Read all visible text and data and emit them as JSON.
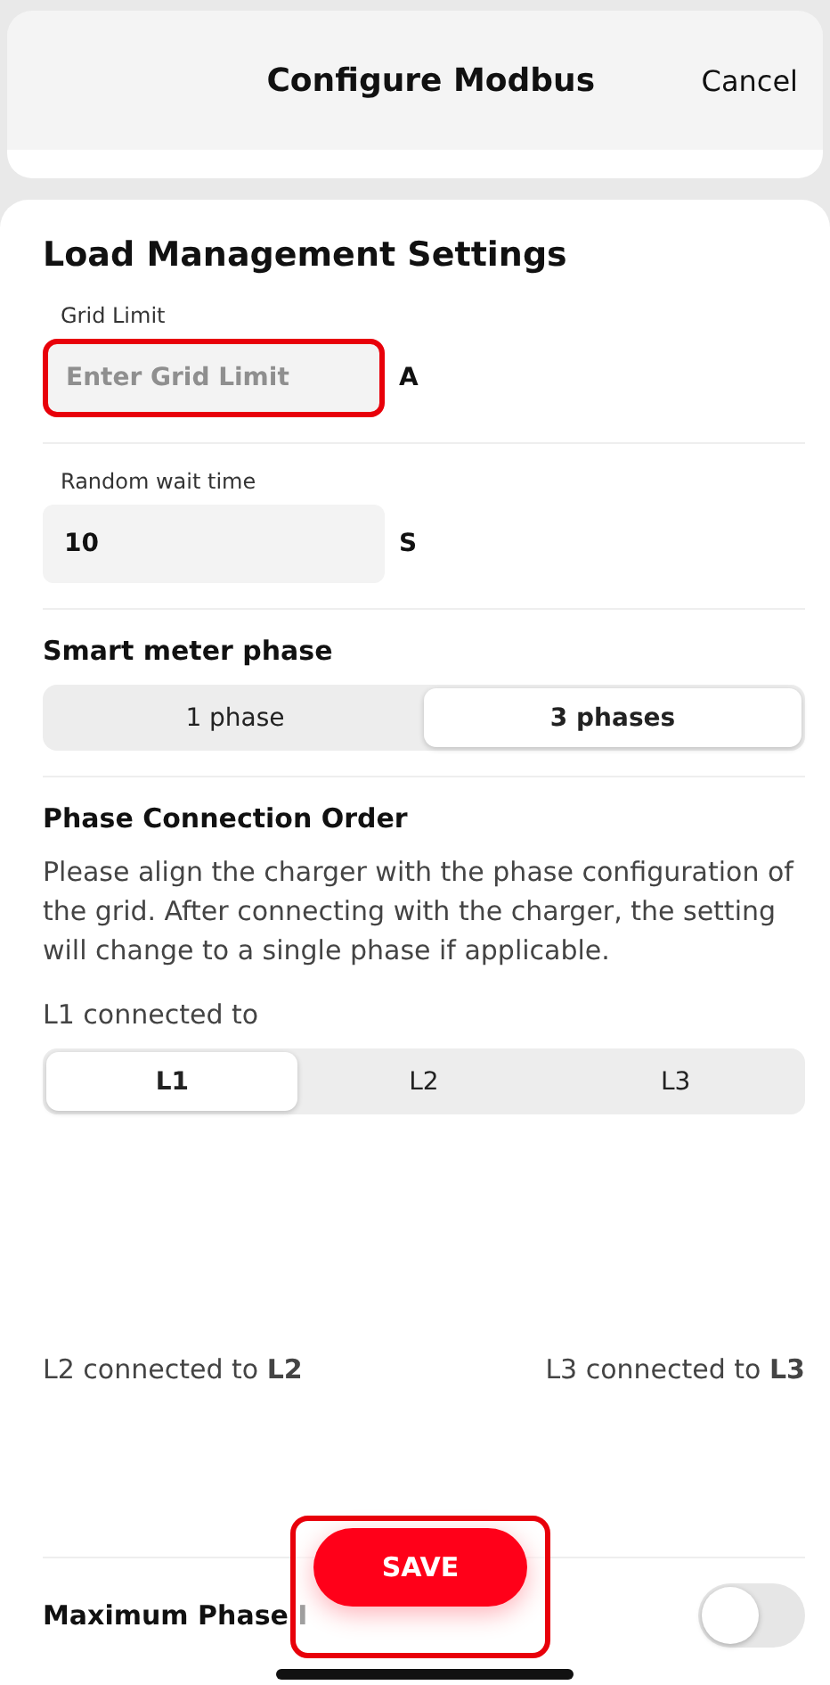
{
  "header": {
    "title": "Configure Modbus",
    "cancel": "Cancel"
  },
  "section_title": "Load Management Settings",
  "grid_limit": {
    "label": "Grid Limit",
    "placeholder": "Enter Grid Limit",
    "unit": "A",
    "highlighted": true
  },
  "wait_time": {
    "label": "Random wait time",
    "value": "10",
    "unit": "S"
  },
  "meter_phase": {
    "title": "Smart meter phase",
    "options": [
      {
        "label": "1 phase",
        "selected": false
      },
      {
        "label": "3 phases",
        "selected": true
      }
    ]
  },
  "phase_order": {
    "title": "Phase Connection Order",
    "description": "Please align the charger with the phase configuration of the grid. After connecting with the charger, the setting will change to a single phase if applicable.",
    "l1_label": "L1 connected to",
    "options": [
      {
        "label": "L1",
        "selected": true
      },
      {
        "label": "L2",
        "selected": false
      },
      {
        "label": "L3",
        "selected": false
      }
    ],
    "l2_text": "L2 connected to **L2**",
    "l3_text": "L3 connected to **L3**"
  },
  "imbalance": {
    "label": "Maximum Phase I",
    "on": false
  },
  "save": {
    "label": "SAVE",
    "highlighted": true
  }
}
